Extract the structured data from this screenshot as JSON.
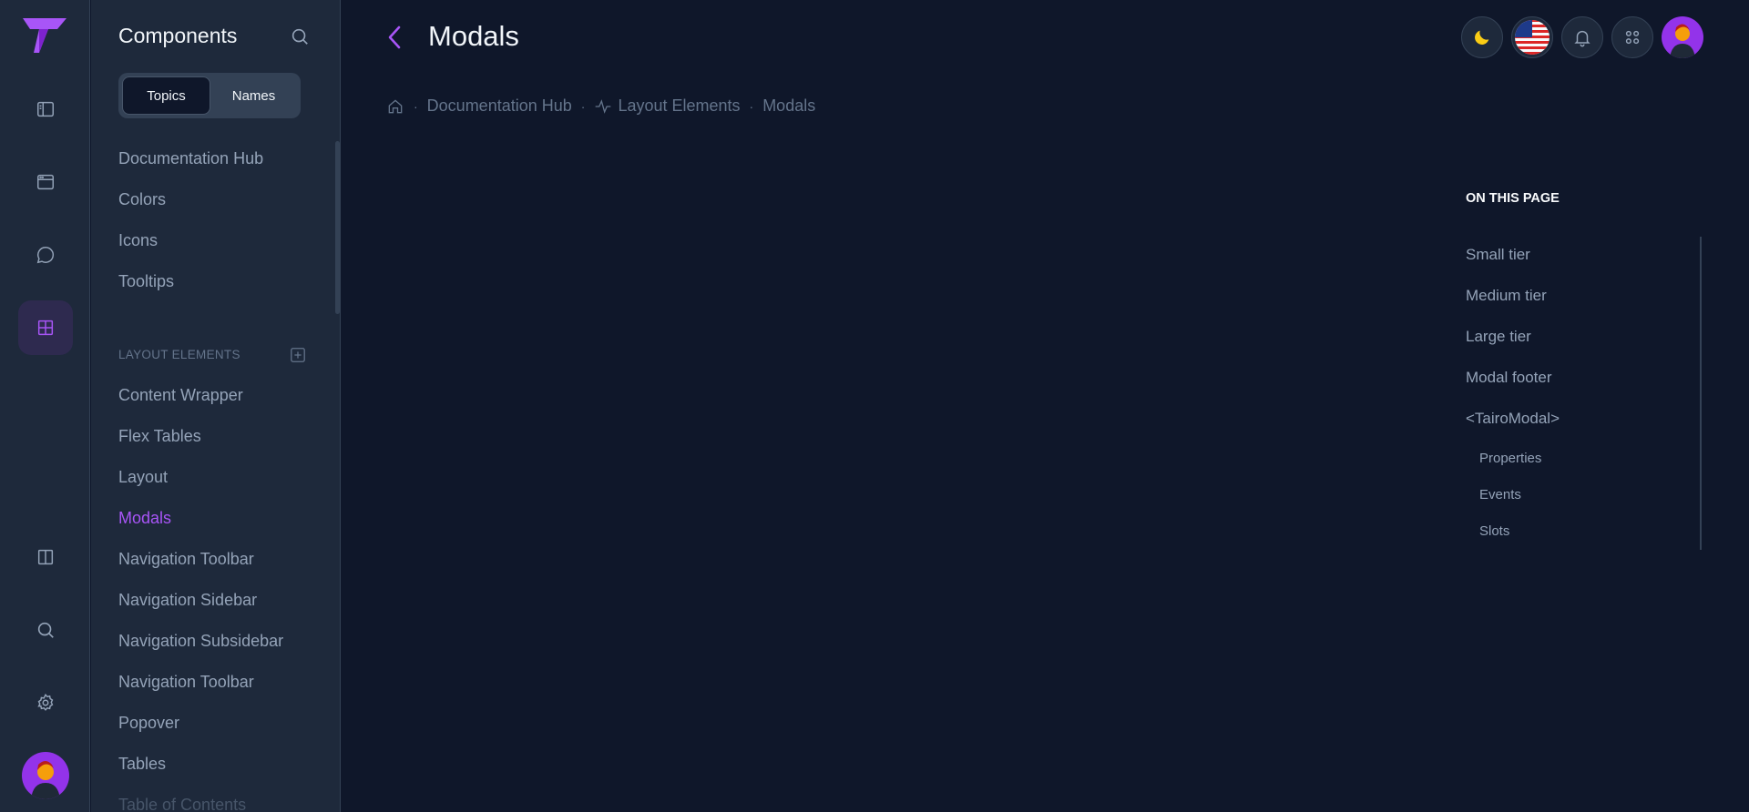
{
  "sidebar": {
    "title": "Components",
    "tabs": [
      "Topics",
      "Names"
    ],
    "items": [
      "Documentation Hub",
      "Colors",
      "Icons",
      "Tooltips"
    ],
    "section_label": "LAYOUT ELEMENTS",
    "layout_items": [
      "Content Wrapper",
      "Flex Tables",
      "Layout",
      "Modals",
      "Navigation Toolbar",
      "Navigation Sidebar",
      "Navigation Subsidebar",
      "Navigation Toolbar",
      "Popover",
      "Tables",
      "Table of Contents"
    ],
    "active_item": "Modals"
  },
  "header": {
    "title": "Modals"
  },
  "breadcrumb": {
    "items": [
      "Documentation Hub",
      "Layout Elements",
      "Modals"
    ]
  },
  "toc": {
    "heading": "ON THIS PAGE",
    "items": [
      "Small tier",
      "Medium tier",
      "Large tier",
      "Modal footer",
      "<TairoModal>"
    ],
    "sub_items": [
      "Properties",
      "Events",
      "Slots"
    ]
  },
  "icons": {
    "rail": [
      "sidebar-icon",
      "browser-icon",
      "chat-icon",
      "grid-icon",
      "columns-icon",
      "search-icon",
      "gear-icon"
    ],
    "toolbar": [
      "moon-icon",
      "us-flag-icon",
      "bell-icon",
      "apps-icon"
    ]
  },
  "colors": {
    "accent": "#a855f7",
    "background": "#0f172a",
    "panel": "#1e293b",
    "moon": "#facc15"
  }
}
